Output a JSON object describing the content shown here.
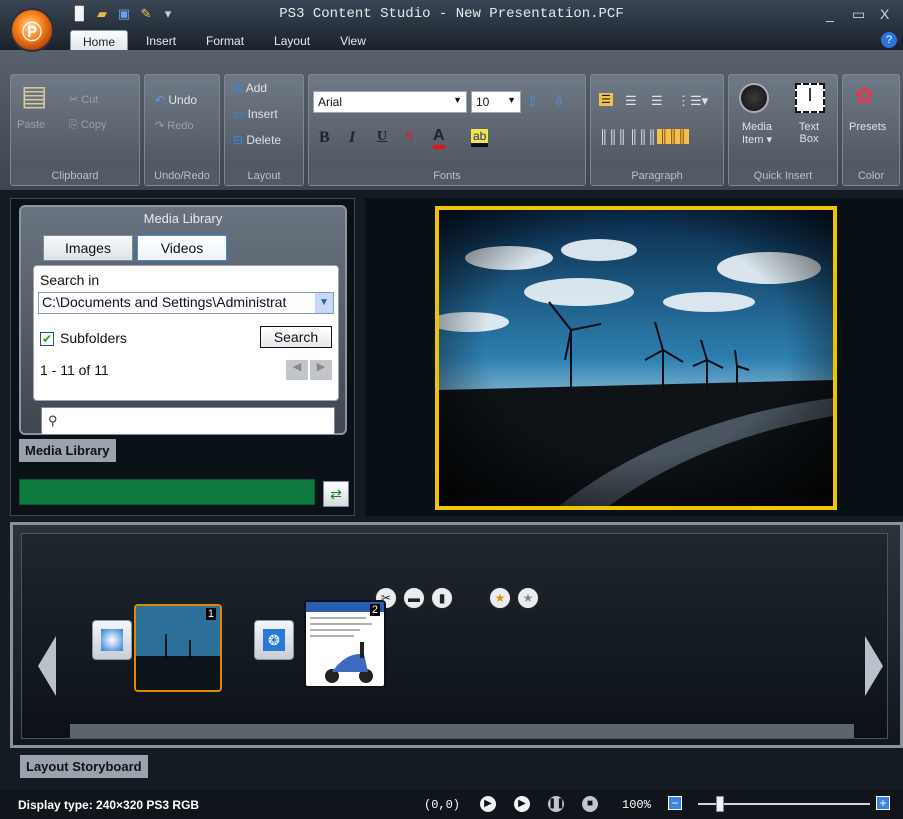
{
  "window": {
    "title": "PS3 Content Studio - New Presentation.PCF",
    "min_label": "_",
    "max_label": "▭",
    "close_label": "X"
  },
  "ribbon_tabs": [
    "Home",
    "Insert",
    "Format",
    "Layout",
    "View"
  ],
  "clipboard": {
    "paste": "Paste",
    "cut": "Cut",
    "copy": "Copy",
    "group": "Clipboard"
  },
  "undoredo": {
    "undo": "Undo",
    "redo": "Redo",
    "group": "Undo/Redo"
  },
  "layout": {
    "add": "Add",
    "insert": "Insert",
    "delete": "Delete",
    "group": "Layout"
  },
  "fonts": {
    "font": "Arial",
    "size": "10",
    "bold": "B",
    "italic": "I",
    "underline": "U",
    "shadow": "S",
    "color_label": "A",
    "highlight": "ab",
    "group": "Fonts"
  },
  "paragraph": {
    "group": "Paragraph"
  },
  "quickinsert": {
    "media": "Media Item ▾",
    "textbox": "Text Box",
    "group": "Quick Insert"
  },
  "color": {
    "presets": "Presets",
    "group": "Color"
  },
  "media": {
    "title": "Media Library",
    "tab_images": "Images",
    "tab_videos": "Videos",
    "search_in_label": "Search in",
    "path": "C:\\Documents and Settings\\Administrat",
    "subfolders": "Subfolders",
    "search_button": "Search",
    "count": "1 - 11 of 11",
    "panel_tab": "Media Library"
  },
  "storyboard": {
    "panel_tab": "Layout Storyboard",
    "slide1_num": "1",
    "slide2_num": "2"
  },
  "status": {
    "display_type": "Display type: 240×320 PS3 RGB",
    "coords": "(0,0)",
    "zoom": "100%"
  }
}
